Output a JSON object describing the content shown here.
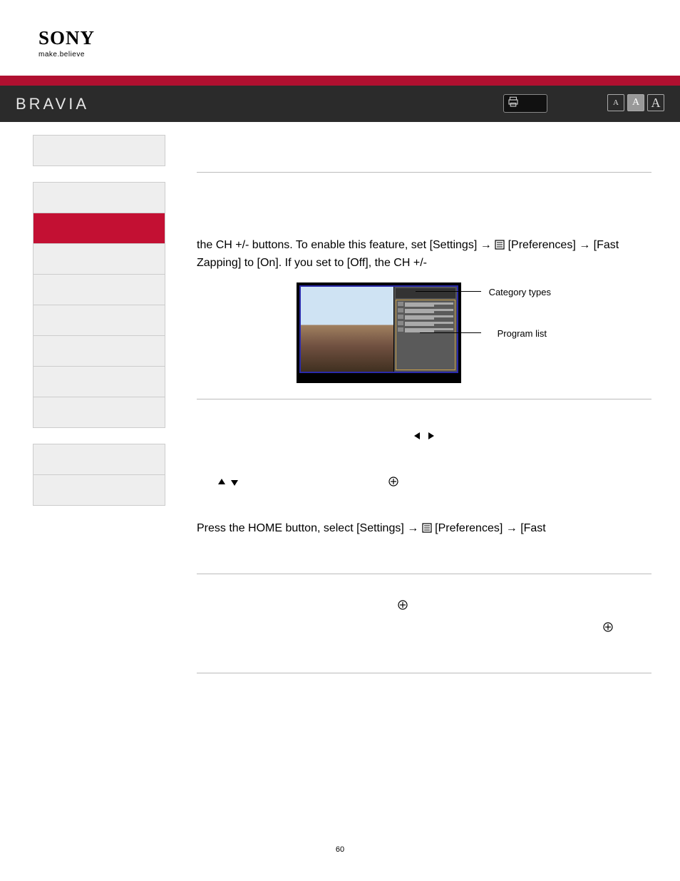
{
  "header": {
    "brand": "SONY",
    "tagline": "make.believe",
    "product_line": "BRAVIA"
  },
  "topbar": {
    "print_icon_name": "print-icon",
    "font_small": "A",
    "font_med": "A",
    "font_large": "A"
  },
  "sidebar": {
    "group1": [
      {
        "active": false
      }
    ],
    "group2": [
      {
        "active": false
      },
      {
        "active": true
      },
      {
        "active": false
      },
      {
        "active": false
      },
      {
        "active": false
      },
      {
        "active": false
      },
      {
        "active": false
      },
      {
        "active": false
      }
    ],
    "group3": [
      {
        "active": false
      },
      {
        "active": false
      }
    ]
  },
  "content": {
    "p1a": "the CH +/- buttons. To enable this feature, set [Settings] → ",
    "p1b": " [Preferences] → [Fast Zapping] to [On]. If you set to [Off], the CH +/-",
    "callout1": "Category types",
    "callout2": "Program list",
    "p2a": "Press the HOME button, select [Settings] → ",
    "p2b": " [Preferences] → [Fast"
  },
  "glyphs": {
    "arrow_left": "◀",
    "arrow_right": "▶",
    "arrow_up": "▲",
    "arrow_down": "▼",
    "circle_plus": "⊕"
  },
  "page_number": "60"
}
